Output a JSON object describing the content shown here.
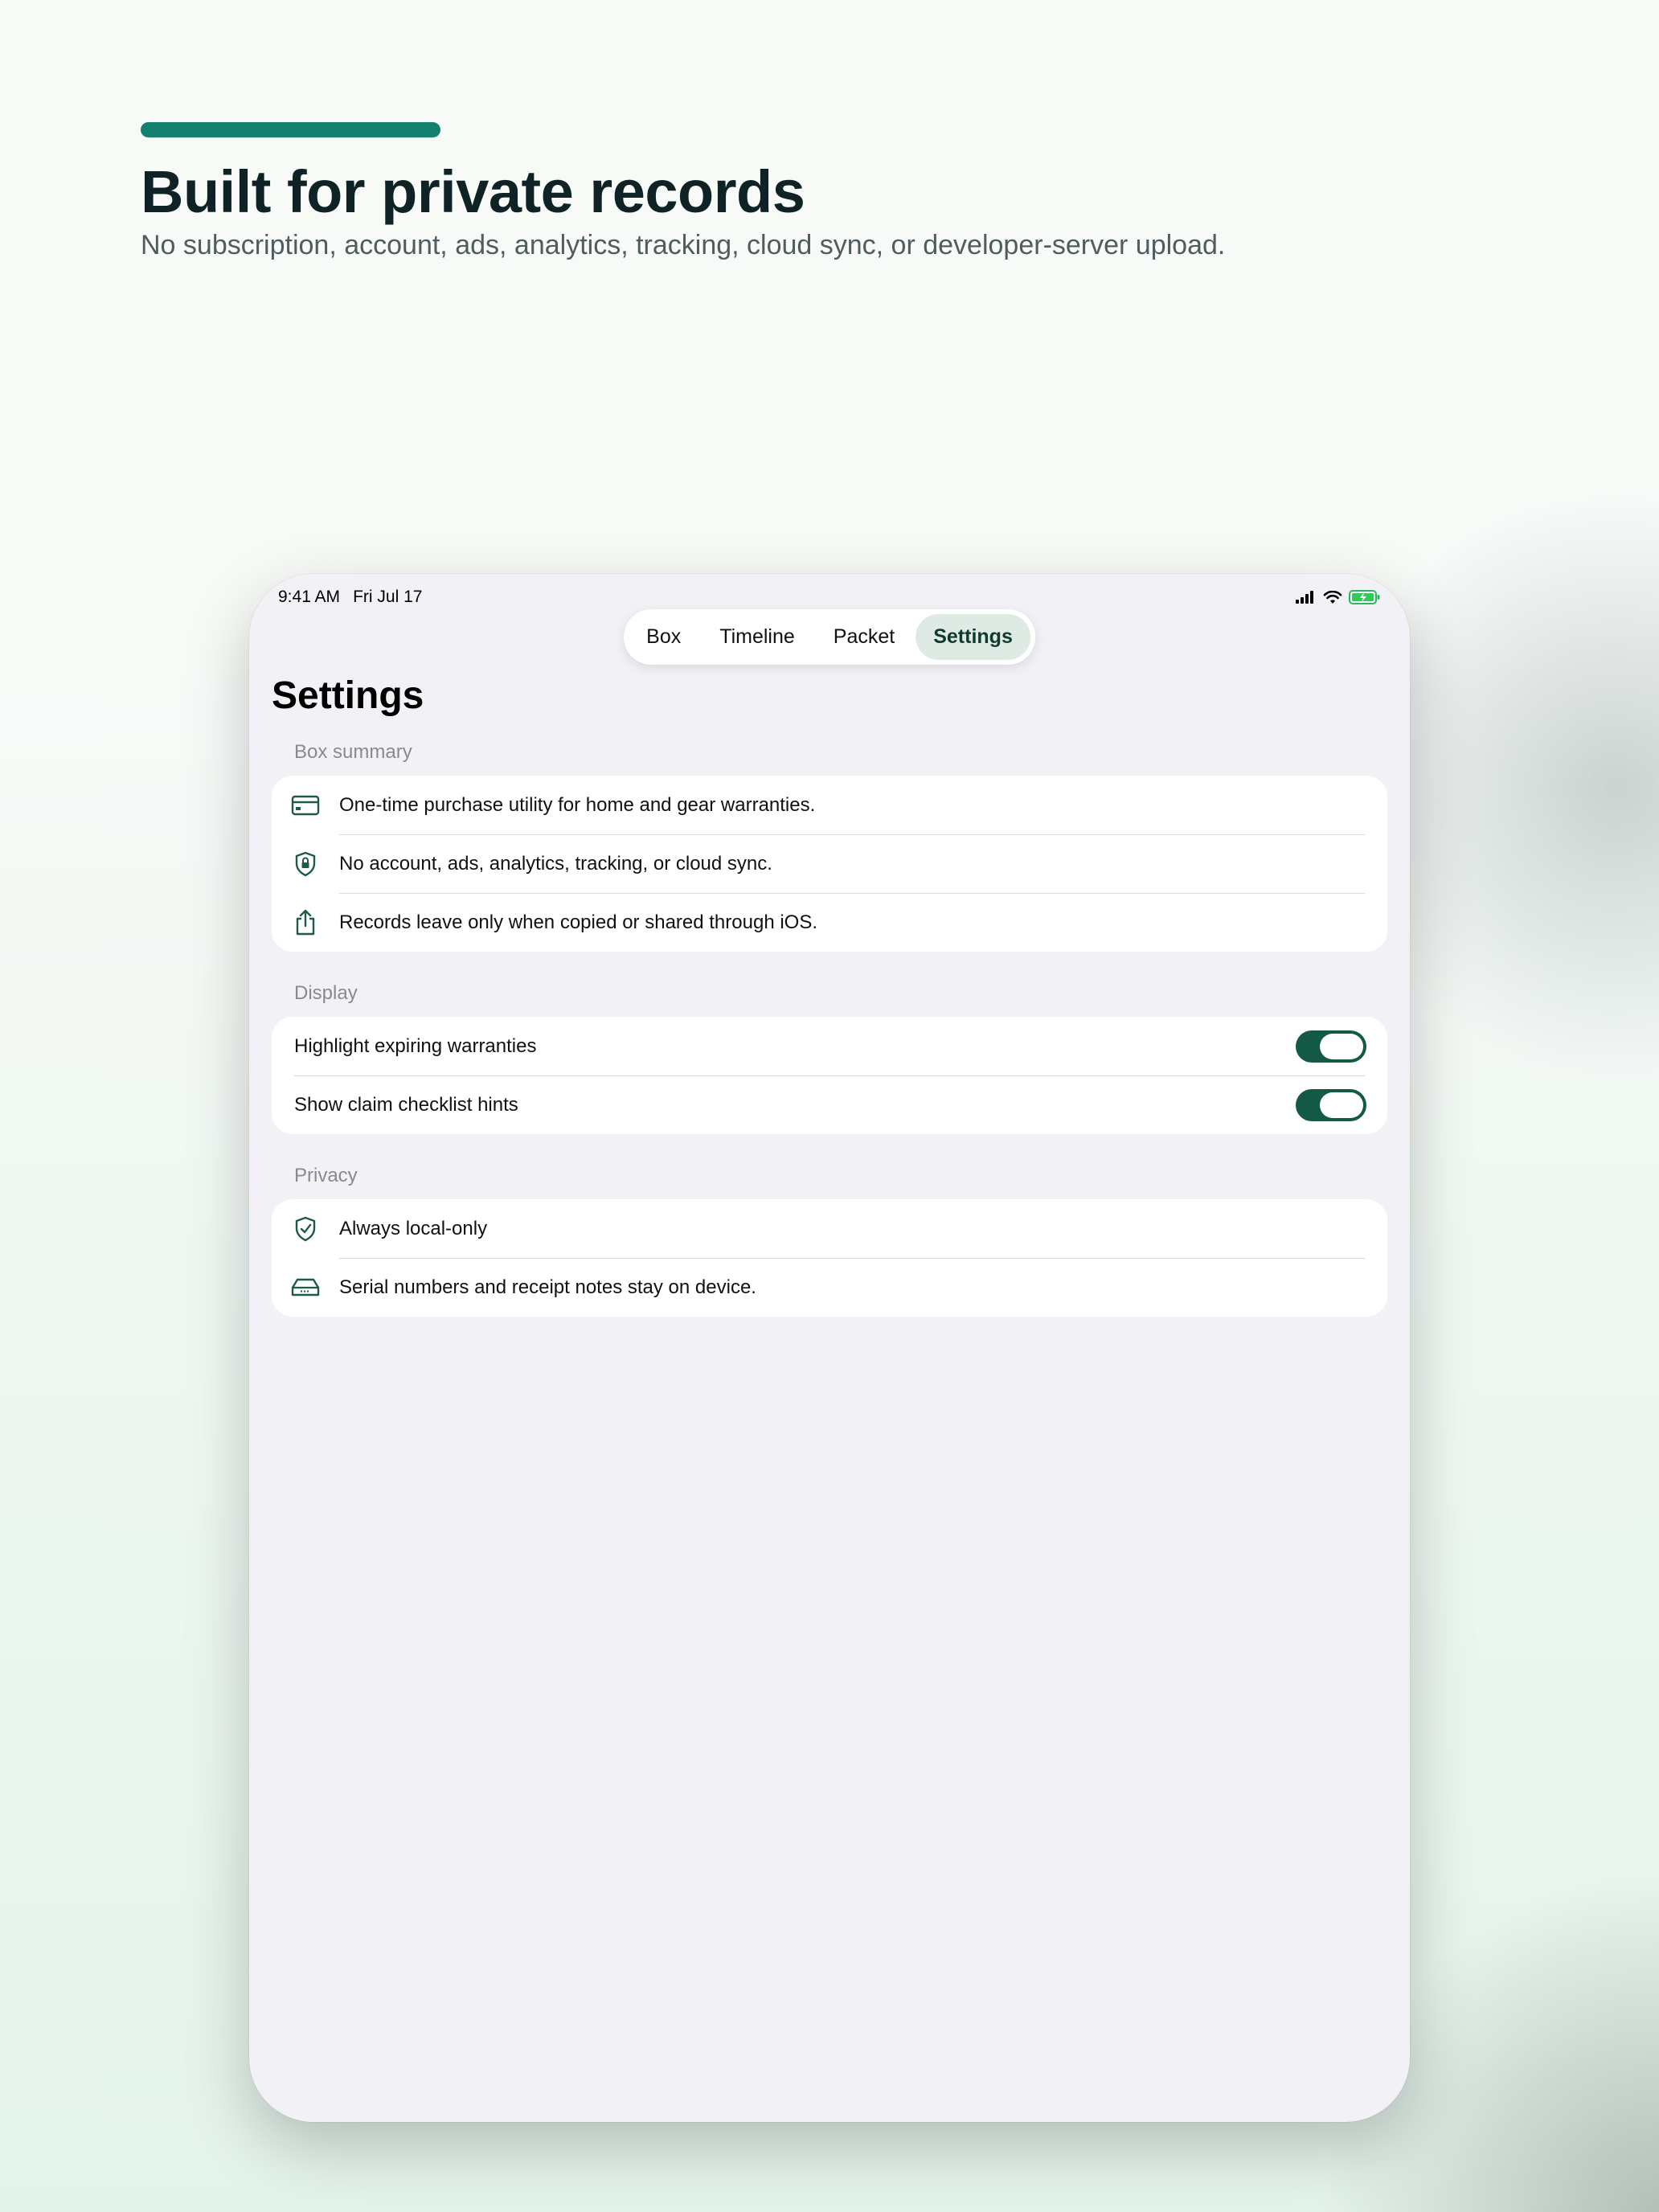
{
  "hero": {
    "title": "Built for private records",
    "subtitle": "No subscription, account, ads, analytics, tracking, cloud sync, or developer-server upload."
  },
  "status_bar": {
    "time": "9:41 AM",
    "date": "Fri Jul 17"
  },
  "tabs": [
    {
      "label": "Box",
      "active": false
    },
    {
      "label": "Timeline",
      "active": false
    },
    {
      "label": "Packet",
      "active": false
    },
    {
      "label": "Settings",
      "active": true
    }
  ],
  "page_title": "Settings",
  "sections": {
    "box_summary": {
      "label": "Box summary",
      "items": [
        {
          "icon": "credit-card-icon",
          "text": "One-time purchase utility for home and gear warranties."
        },
        {
          "icon": "lock-shield-icon",
          "text": "No account, ads, analytics, tracking, or cloud sync."
        },
        {
          "icon": "share-icon",
          "text": "Records leave only when copied or shared through iOS."
        }
      ]
    },
    "display": {
      "label": "Display",
      "items": [
        {
          "text": "Highlight expiring warranties",
          "toggle_on": true
        },
        {
          "text": "Show claim checklist hints",
          "toggle_on": true
        }
      ]
    },
    "privacy": {
      "label": "Privacy",
      "items": [
        {
          "icon": "checkmark-shield-icon",
          "text": "Always local-only"
        },
        {
          "icon": "storage-drive-icon",
          "text": "Serial numbers and receipt notes stay on device."
        }
      ]
    }
  },
  "colors": {
    "accent": "#12826e",
    "toggle_on": "#145846",
    "icon": "#1f5a4a",
    "active_tab_bg": "#dfeae4"
  }
}
